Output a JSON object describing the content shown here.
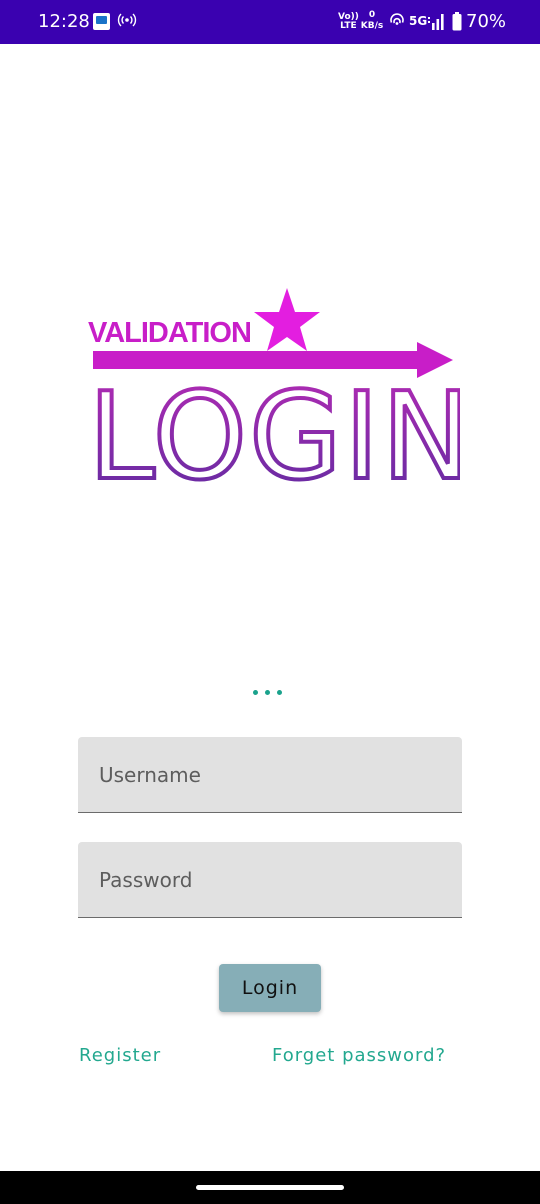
{
  "status_bar": {
    "time": "12:28",
    "volte_top": "Vo))",
    "volte_bottom": "LTE",
    "speed_value": "0",
    "speed_unit": "KB/s",
    "network": "5G",
    "battery": "70%",
    "background_color": "#3a01b0",
    "icons": [
      "app-notification-icon",
      "hotspot-icon",
      "wifi-calling-icon",
      "signal-icon",
      "battery-icon"
    ]
  },
  "logo": {
    "line1": "VALIDATION",
    "line2": "LOGIN",
    "colors": {
      "primary": "#c81ec8",
      "gradient_top": "#b42bb4",
      "gradient_bottom": "#5e2ba0"
    },
    "icons": [
      "star-icon",
      "arrow-icon"
    ]
  },
  "form": {
    "username": {
      "placeholder": "Username",
      "value": ""
    },
    "password": {
      "placeholder": "Password",
      "value": ""
    },
    "login_label": "Login"
  },
  "links": {
    "register": "Register",
    "forgot_password": "Forget password?"
  },
  "colors": {
    "accent": "#23a88f",
    "button": "#86aeb7",
    "field_background": "#e1e1e1"
  }
}
